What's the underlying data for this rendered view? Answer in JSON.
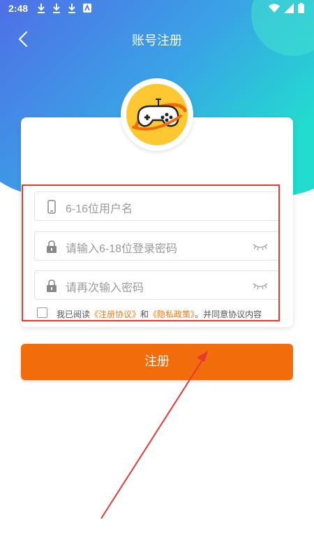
{
  "status_bar": {
    "time": "2:48",
    "icons": [
      "download-icon",
      "download-icon",
      "download-icon",
      "a-icon"
    ],
    "right_icons": [
      "wifi-icon",
      "signal-icon",
      "battery-icon"
    ]
  },
  "header": {
    "title": "账号注册",
    "back_icon": "chevron-left-icon"
  },
  "logo": {
    "icon": "gamepad-icon",
    "color": "#FDC832"
  },
  "form": {
    "username_placeholder": "6-16位用户名",
    "password_placeholder": "请输入6-18位登录密码",
    "confirm_placeholder": "请再次输入密码",
    "agreement": {
      "prefix": "我已阅读",
      "terms_link": "《注册协议》",
      "and": "和",
      "privacy_link": "《隐私政策》",
      "suffix": "。并同意协议内容"
    }
  },
  "register_button": "注册",
  "colors": {
    "accent": "#F26C0C",
    "link": "#F07A1A",
    "gradient_start": "#4A7BE8",
    "gradient_end": "#26D6D6",
    "highlight": "#E53935"
  }
}
